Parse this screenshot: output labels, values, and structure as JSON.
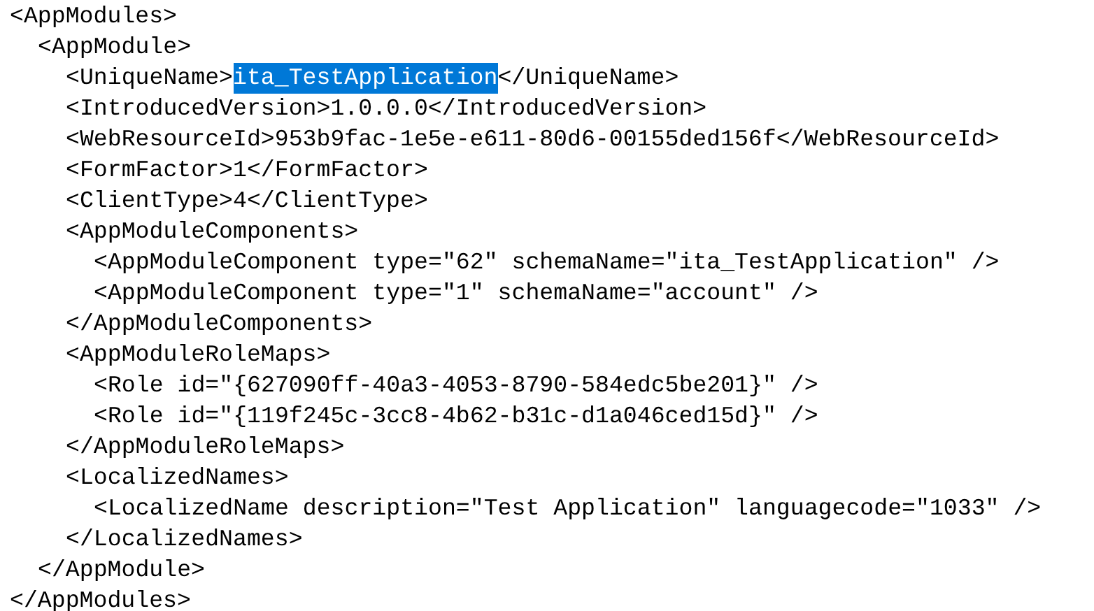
{
  "document": {
    "nodes": [
      {
        "open": [
          {
            "text": "<AppModules>",
            "selected": false
          }
        ],
        "close": "</AppModules>",
        "children": [
          {
            "open": [
              {
                "text": "<AppModule>",
                "selected": false
              }
            ],
            "close": "</AppModule>",
            "children": [
              {
                "open": [
                  {
                    "text": "<UniqueName>",
                    "selected": false
                  },
                  {
                    "text": "ita_TestApplication",
                    "selected": true
                  },
                  {
                    "text": "</UniqueName>",
                    "selected": false
                  }
                ]
              },
              {
                "open": [
                  {
                    "text": "<IntroducedVersion>1.0.0.0</IntroducedVersion>",
                    "selected": false
                  }
                ]
              },
              {
                "open": [
                  {
                    "text": "<WebResourceId>953b9fac-1e5e-e611-80d6-00155ded156f</WebResourceId>",
                    "selected": false
                  }
                ]
              },
              {
                "open": [
                  {
                    "text": "<FormFactor>1</FormFactor>",
                    "selected": false
                  }
                ]
              },
              {
                "open": [
                  {
                    "text": "<ClientType>4</ClientType>",
                    "selected": false
                  }
                ]
              },
              {
                "open": [
                  {
                    "text": "<AppModuleComponents>",
                    "selected": false
                  }
                ],
                "close": "</AppModuleComponents>",
                "children": [
                  {
                    "open": [
                      {
                        "text": "<AppModuleComponent type=\"62\" schemaName=\"ita_TestApplication\" />",
                        "selected": false
                      }
                    ]
                  },
                  {
                    "open": [
                      {
                        "text": "<AppModuleComponent type=\"1\" schemaName=\"account\" />",
                        "selected": false
                      }
                    ]
                  }
                ]
              },
              {
                "open": [
                  {
                    "text": "<AppModuleRoleMaps>",
                    "selected": false
                  }
                ],
                "close": "</AppModuleRoleMaps>",
                "children": [
                  {
                    "open": [
                      {
                        "text": "<Role id=\"{627090ff-40a3-4053-8790-584edc5be201}\" />",
                        "selected": false
                      }
                    ]
                  },
                  {
                    "open": [
                      {
                        "text": "<Role id=\"{119f245c-3cc8-4b62-b31c-d1a046ced15d}\" />",
                        "selected": false
                      }
                    ]
                  }
                ]
              },
              {
                "open": [
                  {
                    "text": "<LocalizedNames>",
                    "selected": false
                  }
                ],
                "close": "</LocalizedNames>",
                "children": [
                  {
                    "open": [
                      {
                        "text": "<LocalizedName description=\"Test Application\" languagecode=\"1033\" />",
                        "selected": false
                      }
                    ]
                  }
                ]
              }
            ]
          }
        ]
      }
    ]
  }
}
